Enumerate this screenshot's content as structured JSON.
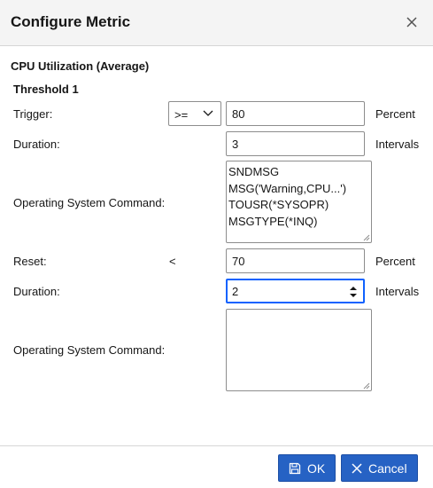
{
  "dialog": {
    "title": "Configure Metric",
    "metric_name": "CPU Utilization (Average)",
    "section_title": "Threshold 1"
  },
  "trigger": {
    "label": "Trigger:",
    "operator": ">=",
    "value": "80",
    "unit": "Percent"
  },
  "trigger_duration": {
    "label": "Duration:",
    "value": "3",
    "unit": "Intervals"
  },
  "trigger_command": {
    "label": "Operating System Command:",
    "lines": [
      "SNDMSG",
      "MSG('Warning,CPU...')",
      "TOUSR(*SYSOPR)",
      "MSGTYPE(*INQ)"
    ]
  },
  "reset": {
    "label": "Reset:",
    "operator": "<",
    "value": "70",
    "unit": "Percent"
  },
  "reset_duration": {
    "label": "Duration:",
    "value": "2",
    "unit": "Intervals"
  },
  "reset_command": {
    "label": "Operating System Command:",
    "lines": []
  },
  "footer": {
    "ok_label": "OK",
    "cancel_label": "Cancel"
  },
  "colors": {
    "primary_button": "#2662c4",
    "focus_border": "#0f62fe",
    "header_bg": "#f4f4f4"
  },
  "icons": {
    "close": "close-icon",
    "save": "save-icon",
    "cancel": "x-icon",
    "dropdown": "chevron-down-icon",
    "stepper": "stepper-arrows-icon"
  }
}
